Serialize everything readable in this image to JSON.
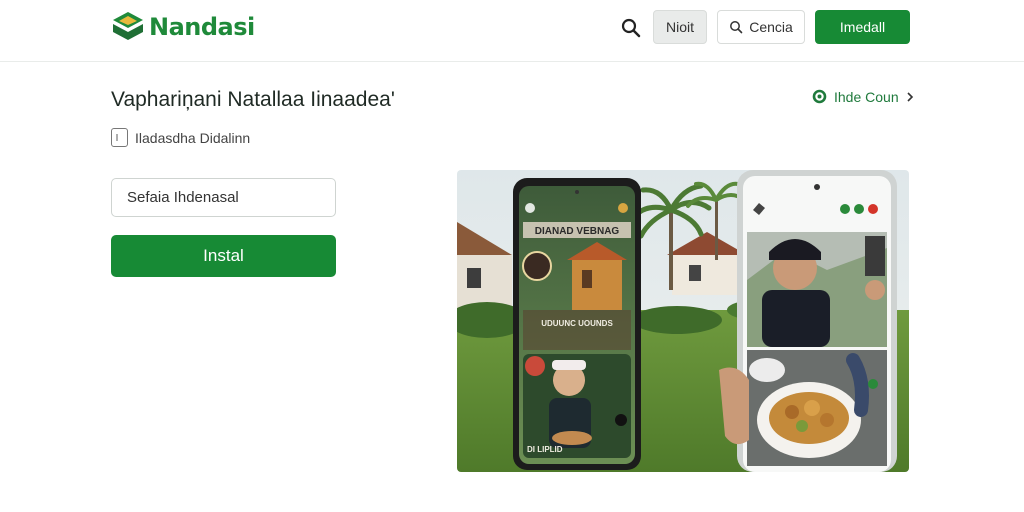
{
  "header": {
    "logo_text": "Nandasi",
    "logo_tagline": "",
    "grey_button_label": "Nioit",
    "search_button_label": "Cencia",
    "primary_button_label": "Imedall"
  },
  "main": {
    "title": "Vaphariņani Natallaa Iinaadea'",
    "hide_link_label": "Ihde Coun",
    "checkbox_label": "Iladasdha Didalinn",
    "input_value": "Sefaia Ihdenasal",
    "install_label": "Instal"
  },
  "hero": {
    "left_phone_banner": "DIANAD VEBNAG",
    "left_phone_caption": "UDUUNC UOUNDS",
    "left_phone_footer": "DI LIPLID"
  },
  "colors": {
    "accent": "#178a35",
    "link": "#1f7a3c"
  },
  "icons": {
    "logo": "nandasi-logo-icon",
    "search": "search-icon",
    "hide": "hide-icon",
    "chevron": "chevron-right-icon",
    "checkbox": "checkbox-icon"
  }
}
